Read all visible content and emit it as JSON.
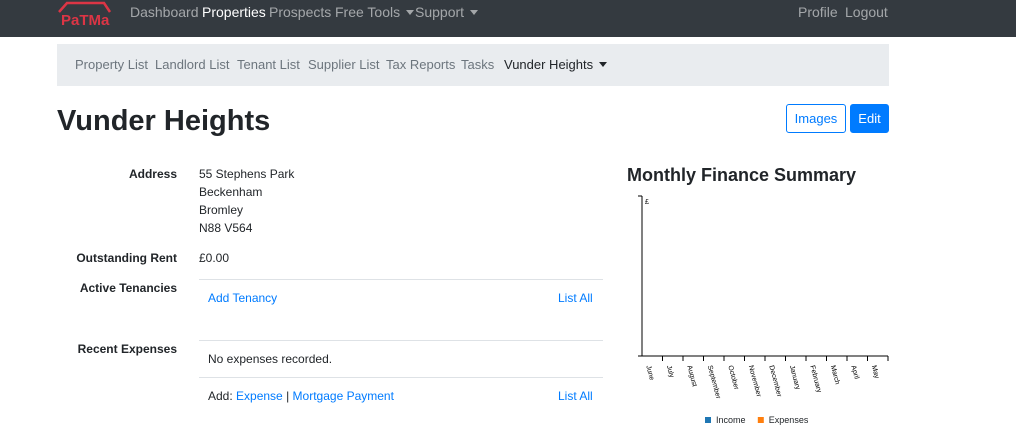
{
  "navbar": {
    "brand": "PaTMa",
    "links": [
      {
        "label": "Dashboard"
      },
      {
        "label": "Properties"
      },
      {
        "label": "Prospects"
      },
      {
        "label": "Free Tools"
      },
      {
        "label": "Support"
      }
    ],
    "right": [
      {
        "label": "Profile"
      },
      {
        "label": "Logout"
      }
    ]
  },
  "subnav": {
    "items": [
      {
        "label": "Property List"
      },
      {
        "label": "Landlord List"
      },
      {
        "label": "Tenant List"
      },
      {
        "label": "Supplier List"
      },
      {
        "label": "Tax Reports"
      },
      {
        "label": "Tasks"
      },
      {
        "label": "Vunder Heights"
      }
    ]
  },
  "page": {
    "title": "Vunder Heights",
    "images_button": "Images",
    "edit_button": "Edit"
  },
  "details": {
    "address_label": "Address",
    "address_lines": [
      "55 Stephens Park",
      "Beckenham",
      "Bromley",
      "N88 V564"
    ],
    "outstanding_label": "Outstanding Rent",
    "outstanding_value": "£0.00",
    "tenancies_label": "Active Tenancies",
    "add_tenancy": "Add Tenancy",
    "tenancies_list_all": "List All",
    "expenses_label": "Recent Expenses",
    "no_expenses": "No expenses recorded.",
    "add_prefix": "Add:",
    "add_expense": "Expense",
    "separator": "|",
    "add_mortgage": "Mortgage Payment",
    "expenses_list_all": "List All"
  },
  "chart_data": {
    "type": "bar",
    "title": "Monthly Finance Summary",
    "ylabel": "£",
    "categories": [
      "June",
      "July",
      "August",
      "September",
      "October",
      "November",
      "December",
      "January",
      "February",
      "March",
      "April",
      "May"
    ],
    "series": [
      {
        "name": "Income",
        "color": "#1f77b4",
        "values": [
          0,
          0,
          0,
          0,
          0,
          0,
          0,
          0,
          0,
          0,
          0,
          0
        ]
      },
      {
        "name": "Expenses",
        "color": "#ff7f0e",
        "values": [
          0,
          0,
          0,
          0,
          0,
          0,
          0,
          0,
          0,
          0,
          0,
          0
        ]
      }
    ],
    "legend": "bottom"
  },
  "colors": {
    "navbar_bg": "#343a40",
    "subnav_bg": "#e9ecef",
    "link": "#007bff",
    "brand": "#dc3545"
  },
  "icons": {
    "brand_logo": "house-roof-logo",
    "dropdown": "caret-down-icon"
  }
}
